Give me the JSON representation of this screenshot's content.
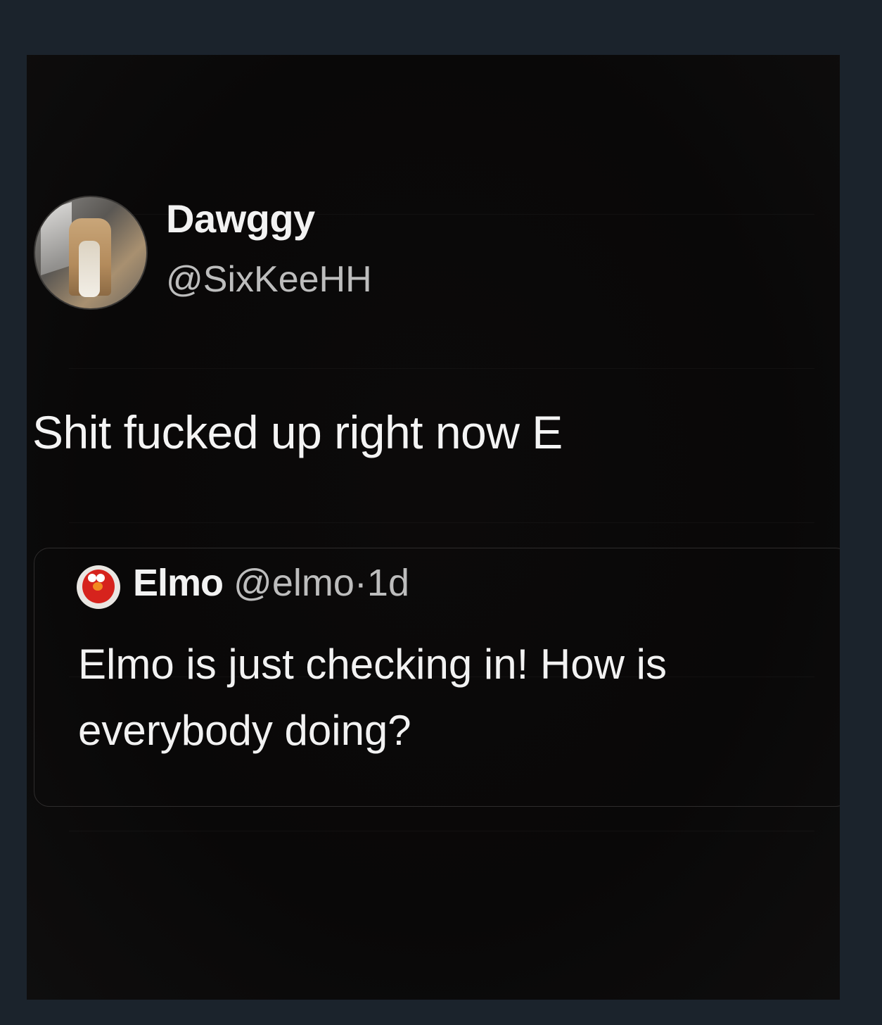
{
  "tweet": {
    "display_name": "Dawggy",
    "handle": "@SixKeeHH",
    "text": "Shit fucked up right now E"
  },
  "quoted_tweet": {
    "display_name": "Elmo",
    "handle": "@elmo",
    "separator": "·",
    "time": "1d",
    "text": "Elmo is just checking in! How is everybody doing?"
  },
  "icons": {
    "author_avatar": "avatar-image",
    "quoted_avatar": "elmo-avatar"
  }
}
